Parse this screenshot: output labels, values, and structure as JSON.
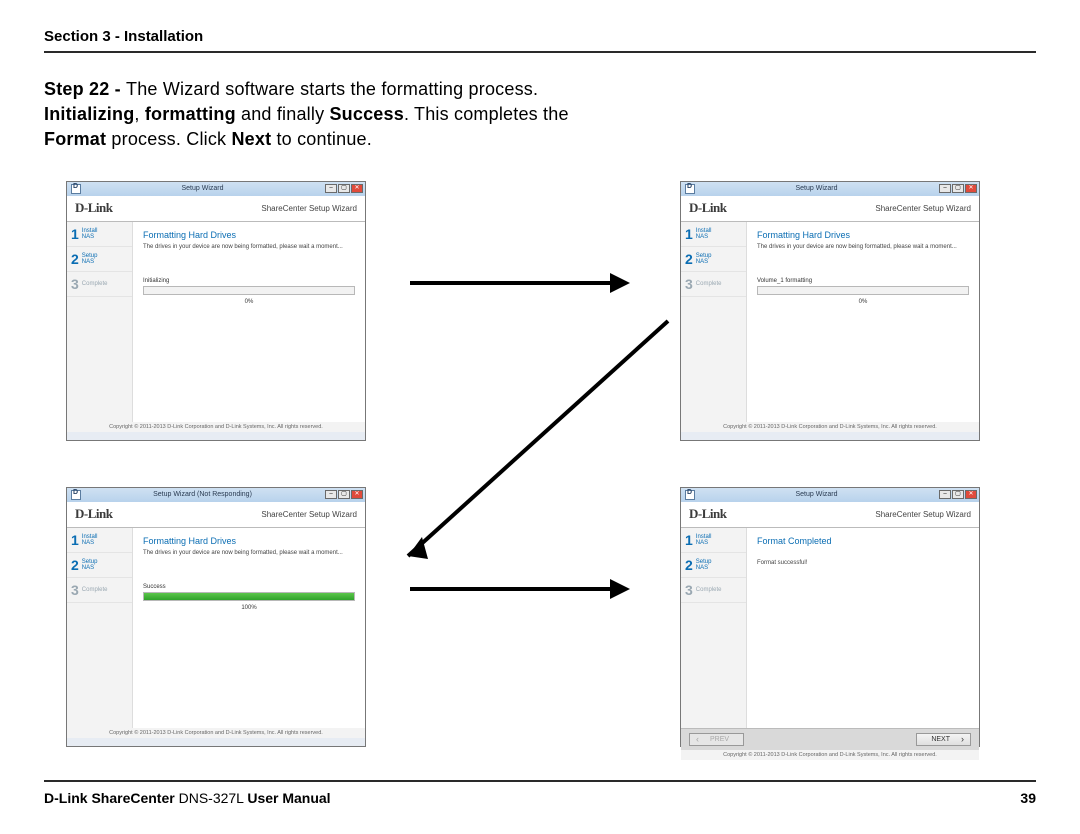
{
  "section_header": "Section 3 - Installation",
  "body": {
    "step_prefix": "Step 22 - ",
    "line1_rest": "The Wizard software starts the formatting process.",
    "bold_initializing": "Initializing",
    "comma": ", ",
    "bold_formatting": "formatting",
    "and_finally": " and finally ",
    "bold_success": "Success",
    "line2_rest": ". This completes the ",
    "bold_format": "Format",
    "line3_rest": " process. Click ",
    "bold_next": "Next",
    "line3_end": " to continue."
  },
  "wizard_common": {
    "window_title": "Setup Wizard",
    "window_title_nr": "Setup Wizard (Not Responding)",
    "brand": "D-Link",
    "subtitle": "ShareCenter Setup Wizard",
    "step1a": "Install",
    "step1b": "NAS",
    "step2a": "Setup",
    "step2b": "NAS",
    "step3": "Complete",
    "heading_format": "Formatting Hard Drives",
    "heading_done": "Format Completed",
    "note": "The drives in your device are now being formatted, please wait a moment...",
    "copyright": "Copyright © 2011-2013 D-Link Corporation and D-Link Systems, Inc. All rights reserved.",
    "prev": "PREV",
    "next": "NEXT"
  },
  "shots": {
    "s1": {
      "status": "Initializing",
      "pct": "0%",
      "fillpct": 0,
      "fillclass": ""
    },
    "s2": {
      "status": "Volume_1 formatting",
      "pct": "0%",
      "fillpct": 0,
      "fillclass": ""
    },
    "s3": {
      "status": "Success",
      "pct": "100%",
      "fillpct": 100,
      "fillclass": "green"
    },
    "s4": {
      "done_note": "Format successful!"
    }
  },
  "footer": {
    "t1": "D-Link ShareCenter",
    "t2": " DNS-327L ",
    "t3": "User Manual",
    "page": "39"
  }
}
